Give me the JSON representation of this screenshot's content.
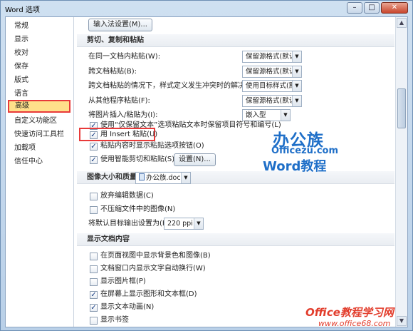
{
  "window": {
    "title": "Word 选项",
    "min": "–",
    "max": "□",
    "close": "✕"
  },
  "nav": {
    "items": [
      {
        "label": "常规"
      },
      {
        "label": "显示"
      },
      {
        "label": "校对"
      },
      {
        "label": "保存"
      },
      {
        "label": "版式"
      },
      {
        "label": "语言"
      },
      {
        "label": "高级",
        "selected": true
      },
      {
        "label": "自定义功能区"
      },
      {
        "label": "快速访问工具栏"
      },
      {
        "label": "加载项"
      },
      {
        "label": "信任中心"
      }
    ]
  },
  "top_button": "输入法设置(M)...",
  "cut_copy_paste": {
    "title": "剪切、复制和粘贴",
    "rows": [
      {
        "label": "在同一文档内粘贴(W):",
        "value": "保留源格式(默认)"
      },
      {
        "label": "跨文档粘贴(B):",
        "value": "保留源格式(默认)"
      },
      {
        "label": "跨文档粘贴的情况下，样式定义发生冲突时的解决方法(E):",
        "value": "使用目标样式(默认)"
      },
      {
        "label": "从其他程序粘贴(F):",
        "value": "保留源格式(默认)"
      },
      {
        "label": "将图片插入/粘贴为(I):",
        "value": "嵌入型"
      }
    ],
    "checkboxes": [
      {
        "label": "使用“仅保留文本”选项粘贴文本时保留项目符号和编号(L)",
        "checked": true
      },
      {
        "label": "用 Insert 粘贴(U)",
        "checked": true
      },
      {
        "label": "粘贴内容时显示粘贴选项按钮(O)",
        "checked": true
      },
      {
        "label": "使用智能剪切和粘贴(S)",
        "checked": true
      }
    ],
    "settings_button": "设置(N)..."
  },
  "image_size": {
    "title": "图像大小和质量",
    "doc_name": "办公族.docx",
    "checkboxes": [
      {
        "label": "放弃编辑数据(C)",
        "checked": false
      },
      {
        "label": "不压缩文件中的图像(N)",
        "checked": false
      }
    ],
    "output_label": "将默认目标输出设置为(P):",
    "output_value": "220 ppi"
  },
  "show_doc": {
    "title": "显示文档内容",
    "checkboxes": [
      {
        "label": "在页面视图中显示背景色和图像(B)",
        "checked": false
      },
      {
        "label": "文档窗口内显示文字自动换行(W)",
        "checked": false
      },
      {
        "label": "显示图片框(P)",
        "checked": false
      },
      {
        "label": "在屏幕上显示图形和文本框(D)",
        "checked": true
      },
      {
        "label": "显示文本动画(N)",
        "checked": true
      },
      {
        "label": "显示书签",
        "checked": false
      }
    ]
  },
  "watermark": {
    "brand": "办公族",
    "site": "Officezu.com",
    "tagline": "Word教程",
    "bottom": "Office教程学习网",
    "bottom_url": "www.office68.com"
  },
  "colors": {
    "accent_red": "#e83a3a",
    "selected_bg": "#ffe08a",
    "watermark_blue": "#1f6fc8"
  }
}
